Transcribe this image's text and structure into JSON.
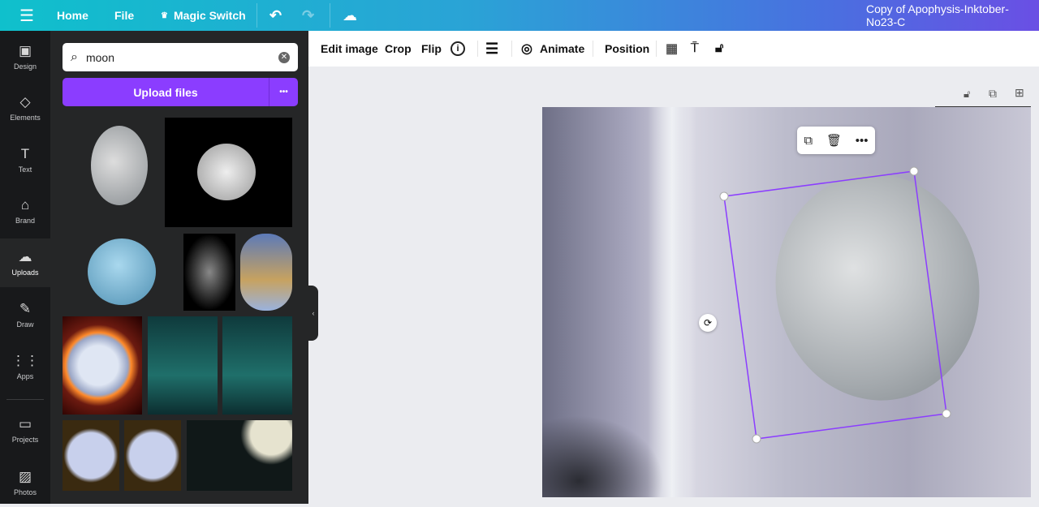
{
  "topbar": {
    "home": "Home",
    "file": "File",
    "magic_switch": "Magic Switch",
    "doc_title": "Copy of Apophysis-Inktober-No23-C"
  },
  "rail": [
    {
      "label": "Design",
      "icon": "▣"
    },
    {
      "label": "Elements",
      "icon": "◇"
    },
    {
      "label": "Text",
      "icon": "T"
    },
    {
      "label": "Brand",
      "icon": "⌂"
    },
    {
      "label": "Uploads",
      "icon": "☁"
    },
    {
      "label": "Draw",
      "icon": "✎"
    },
    {
      "label": "Apps",
      "icon": "⋮⋮"
    },
    {
      "label": "Projects",
      "icon": "▭"
    },
    {
      "label": "Photos",
      "icon": "▨"
    }
  ],
  "panel": {
    "search_value": "moon",
    "upload_label": "Upload files",
    "more": "•••"
  },
  "toolbar": {
    "edit_image": "Edit image",
    "crop": "Crop",
    "flip": "Flip",
    "info": "i",
    "animate": "Animate",
    "position": "Position"
  },
  "colors": {
    "accent": "#8b3dff",
    "rail": "#18191b",
    "panel": "#252627"
  }
}
